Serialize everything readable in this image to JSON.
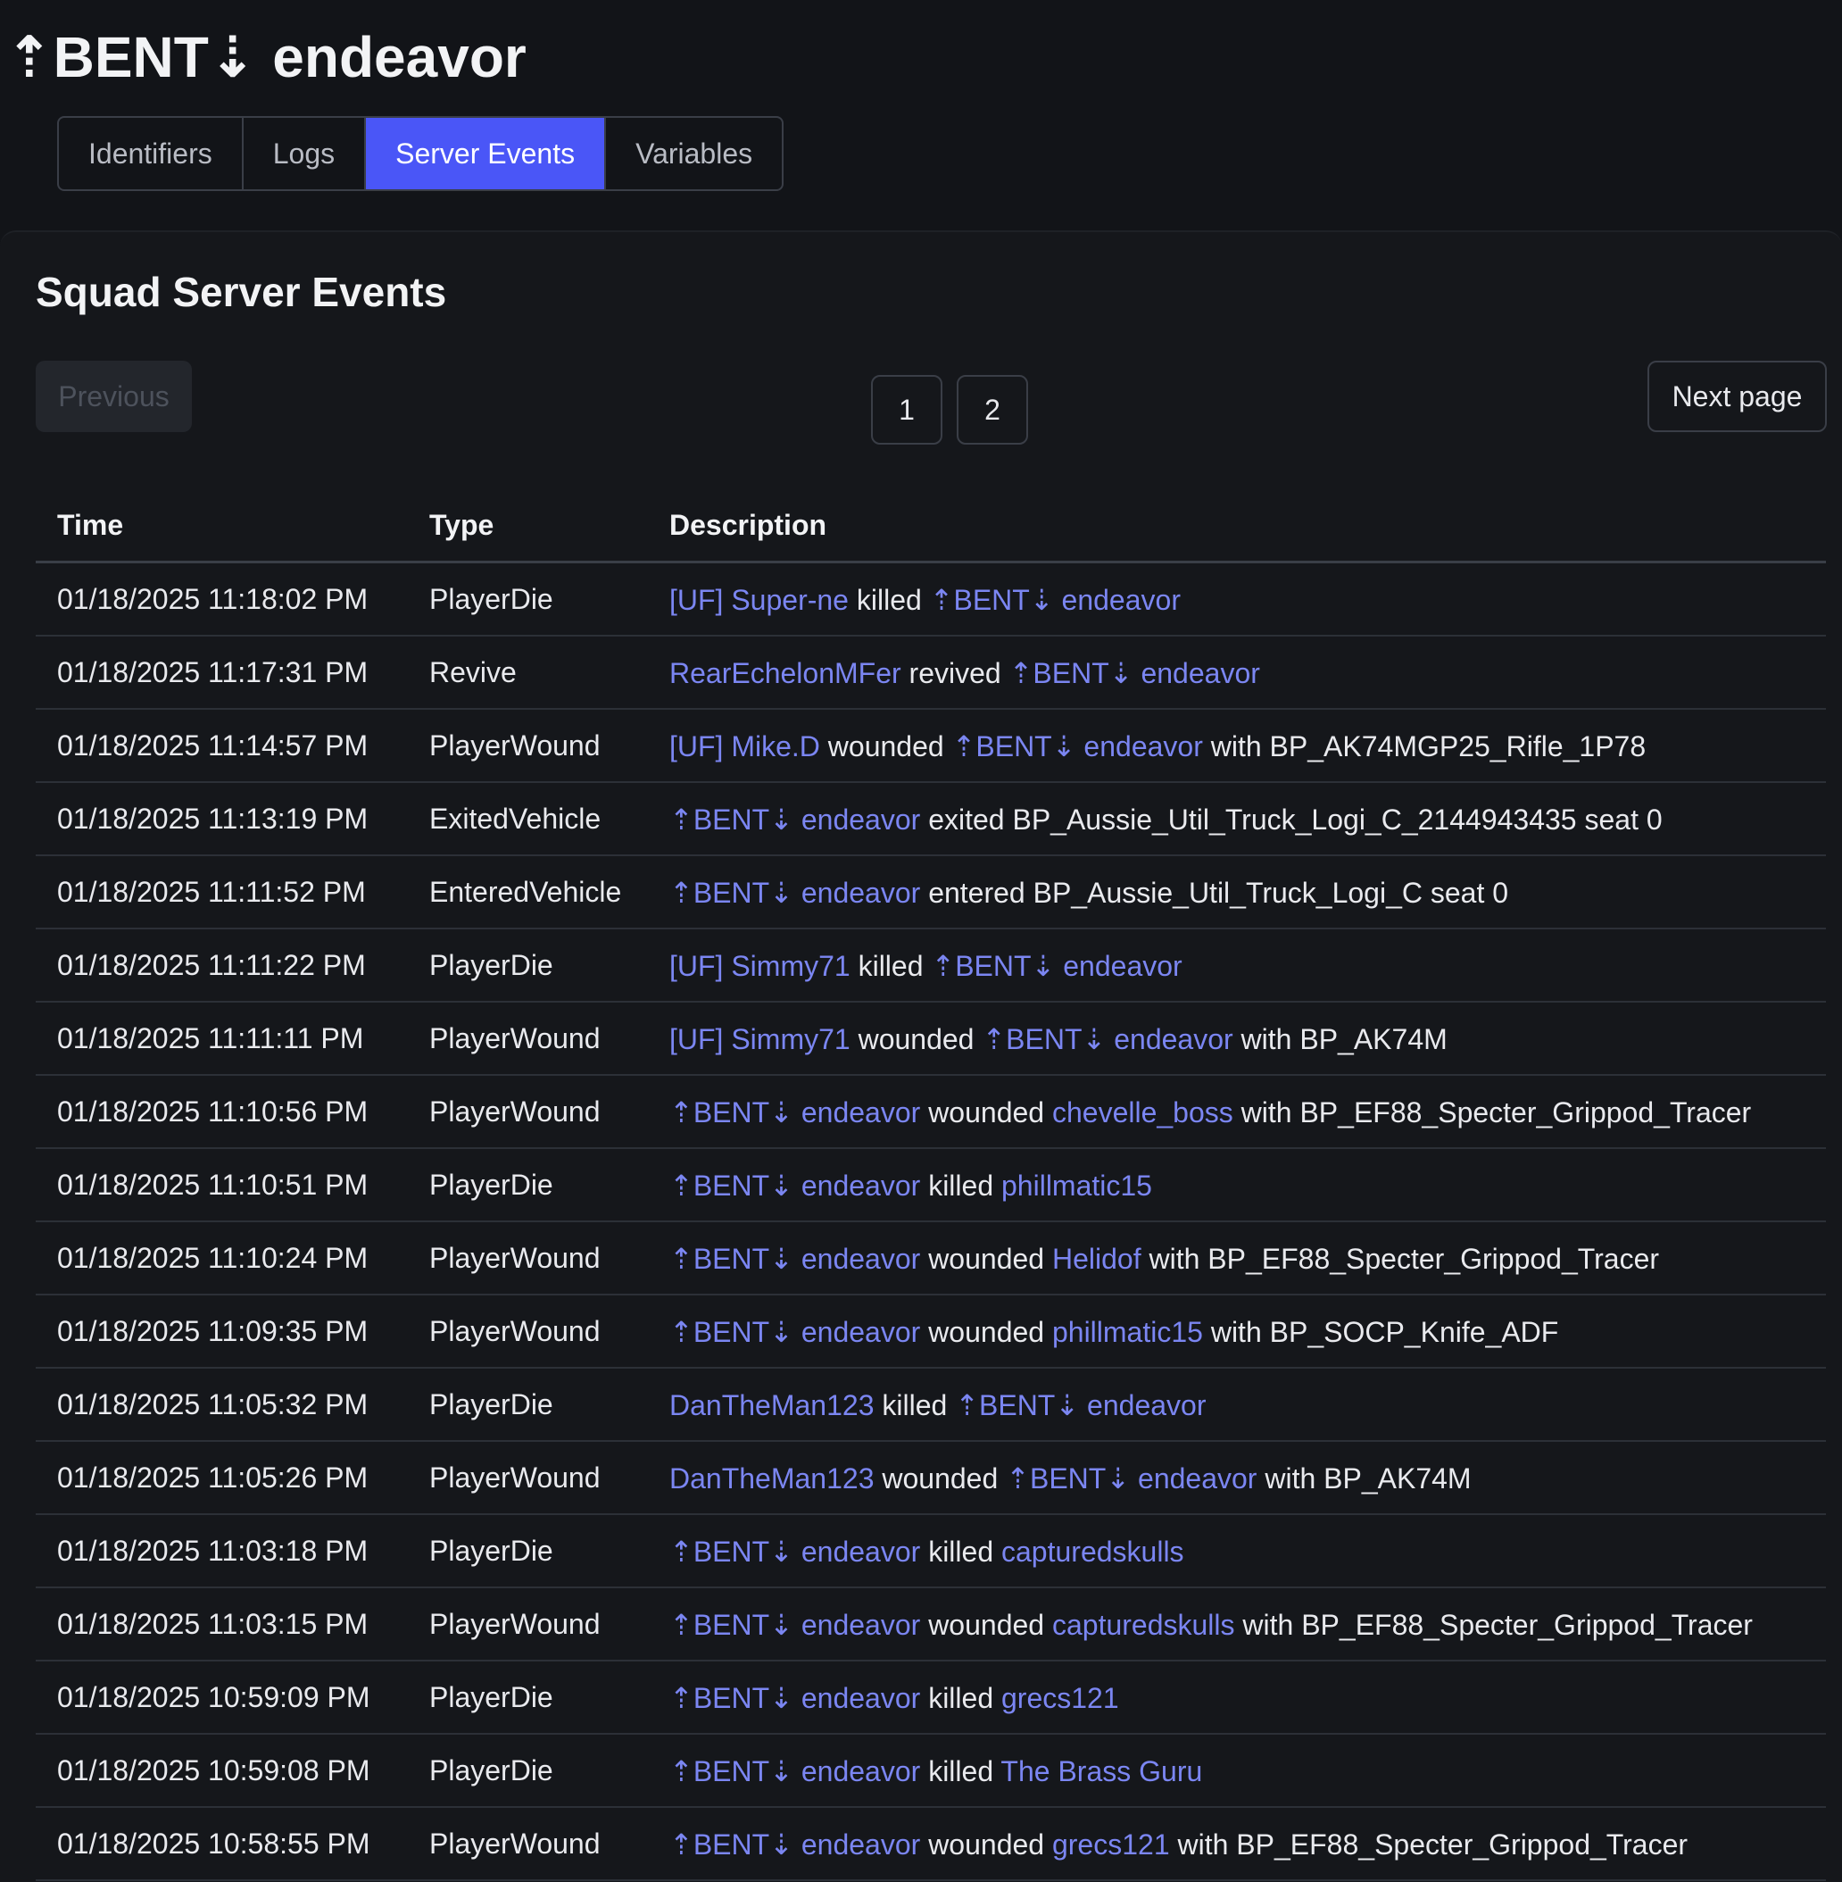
{
  "header": {
    "title": "⇡BENT⇣ endeavor"
  },
  "tabs": [
    {
      "label": "Identifiers",
      "active": false
    },
    {
      "label": "Logs",
      "active": false
    },
    {
      "label": "Server Events",
      "active": true
    },
    {
      "label": "Variables",
      "active": false
    }
  ],
  "section": {
    "title": "Squad Server Events"
  },
  "pagination": {
    "previous_label": "Previous",
    "next_label": "Next page",
    "pages": [
      "1",
      "2"
    ]
  },
  "table": {
    "headers": {
      "time": "Time",
      "type": "Type",
      "description": "Description"
    },
    "rows": [
      {
        "time": "01/18/2025 11:18:02 PM",
        "type": "PlayerDie",
        "actor": "[UF] Super-ne",
        "verb": "killed",
        "target": "⇡BENT⇣ endeavor",
        "tail": ""
      },
      {
        "time": "01/18/2025 11:17:31 PM",
        "type": "Revive",
        "actor": "RearEchelonMFer",
        "verb": "revived",
        "target": "⇡BENT⇣ endeavor",
        "tail": ""
      },
      {
        "time": "01/18/2025 11:14:57 PM",
        "type": "PlayerWound",
        "actor": "[UF] Mike.D",
        "verb": "wounded",
        "target": "⇡BENT⇣ endeavor",
        "tail": "with BP_AK74MGP25_Rifle_1P78"
      },
      {
        "time": "01/18/2025 11:13:19 PM",
        "type": "ExitedVehicle",
        "actor": "⇡BENT⇣ endeavor",
        "verb": "exited BP_Aussie_Util_Truck_Logi_C_2144943435 seat 0",
        "target": "",
        "tail": ""
      },
      {
        "time": "01/18/2025 11:11:52 PM",
        "type": "EnteredVehicle",
        "actor": "⇡BENT⇣ endeavor",
        "verb": "entered BP_Aussie_Util_Truck_Logi_C seat 0",
        "target": "",
        "tail": ""
      },
      {
        "time": "01/18/2025 11:11:22 PM",
        "type": "PlayerDie",
        "actor": "[UF] Simmy71",
        "verb": "killed",
        "target": "⇡BENT⇣ endeavor",
        "tail": ""
      },
      {
        "time": "01/18/2025 11:11:11 PM",
        "type": "PlayerWound",
        "actor": "[UF] Simmy71",
        "verb": "wounded",
        "target": "⇡BENT⇣ endeavor",
        "tail": "with BP_AK74M"
      },
      {
        "time": "01/18/2025 11:10:56 PM",
        "type": "PlayerWound",
        "actor": "⇡BENT⇣ endeavor",
        "verb": "wounded",
        "target": "chevelle_boss",
        "tail": "with BP_EF88_Specter_Grippod_Tracer"
      },
      {
        "time": "01/18/2025 11:10:51 PM",
        "type": "PlayerDie",
        "actor": "⇡BENT⇣ endeavor",
        "verb": "killed",
        "target": "phillmatic15",
        "tail": ""
      },
      {
        "time": "01/18/2025 11:10:24 PM",
        "type": "PlayerWound",
        "actor": "⇡BENT⇣ endeavor",
        "verb": "wounded",
        "target": "Helidof",
        "tail": "with BP_EF88_Specter_Grippod_Tracer"
      },
      {
        "time": "01/18/2025 11:09:35 PM",
        "type": "PlayerWound",
        "actor": "⇡BENT⇣ endeavor",
        "verb": "wounded",
        "target": "phillmatic15",
        "tail": "with BP_SOCP_Knife_ADF"
      },
      {
        "time": "01/18/2025 11:05:32 PM",
        "type": "PlayerDie",
        "actor": "DanTheMan123",
        "verb": "killed",
        "target": "⇡BENT⇣ endeavor",
        "tail": ""
      },
      {
        "time": "01/18/2025 11:05:26 PM",
        "type": "PlayerWound",
        "actor": "DanTheMan123",
        "verb": "wounded",
        "target": "⇡BENT⇣ endeavor",
        "tail": "with BP_AK74M"
      },
      {
        "time": "01/18/2025 11:03:18 PM",
        "type": "PlayerDie",
        "actor": "⇡BENT⇣ endeavor",
        "verb": "killed",
        "target": "capturedskulls",
        "tail": ""
      },
      {
        "time": "01/18/2025 11:03:15 PM",
        "type": "PlayerWound",
        "actor": "⇡BENT⇣ endeavor",
        "verb": "wounded",
        "target": "capturedskulls",
        "tail": "with BP_EF88_Specter_Grippod_Tracer"
      },
      {
        "time": "01/18/2025 10:59:09 PM",
        "type": "PlayerDie",
        "actor": "⇡BENT⇣ endeavor",
        "verb": "killed",
        "target": "grecs121",
        "tail": ""
      },
      {
        "time": "01/18/2025 10:59:08 PM",
        "type": "PlayerDie",
        "actor": "⇡BENT⇣ endeavor",
        "verb": "killed",
        "target": "The Brass Guru",
        "tail": ""
      },
      {
        "time": "01/18/2025 10:58:55 PM",
        "type": "PlayerWound",
        "actor": "⇡BENT⇣ endeavor",
        "verb": "wounded",
        "target": "grecs121",
        "tail": "with BP_EF88_Specter_Grippod_Tracer"
      }
    ]
  },
  "colors": {
    "background": "#121418",
    "accent": "#4a56f7",
    "link": "#7b86f2",
    "text": "#e9eaee"
  }
}
